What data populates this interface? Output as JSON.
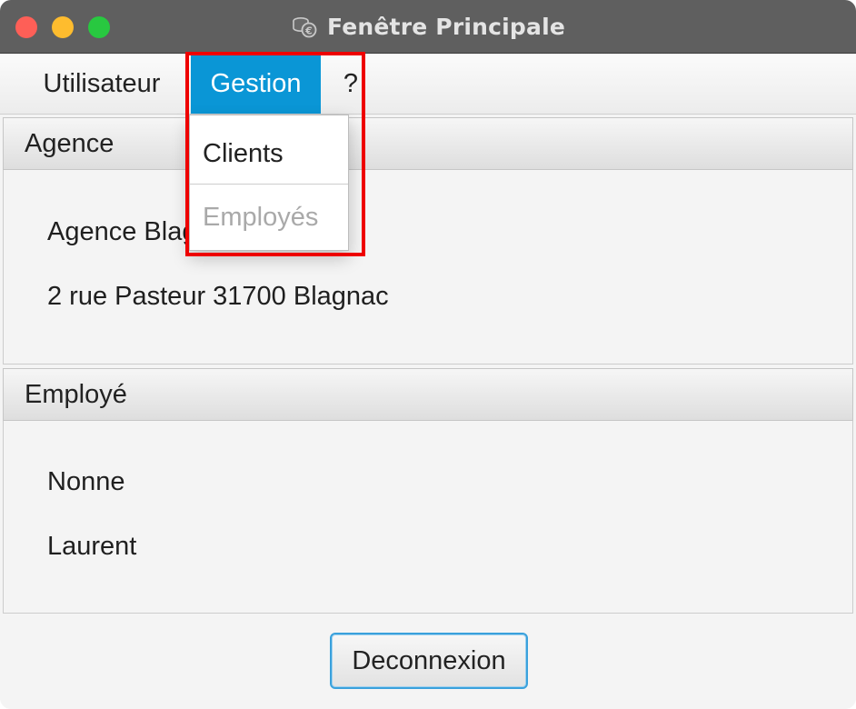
{
  "window": {
    "title": "Fenêtre Principale",
    "title_icon": "coins-icon"
  },
  "menubar": {
    "items": [
      {
        "label": "Utilisateur"
      },
      {
        "label": "Gestion",
        "state": "open"
      },
      {
        "label": "?"
      }
    ]
  },
  "dropdown": {
    "items": [
      {
        "label": "Clients",
        "enabled": true
      },
      {
        "label": "Employés",
        "enabled": false
      }
    ]
  },
  "agence_pane": {
    "title": "Agence",
    "lines": [
      "Agence Blagnac",
      "2 rue Pasteur 31700 Blagnac"
    ]
  },
  "employe_pane": {
    "title": "Employé",
    "lines": [
      "Nonne",
      "Laurent"
    ]
  },
  "footer": {
    "logout_label": "Deconnexion"
  },
  "colors": {
    "titlebar": "#5f5f5f",
    "menu_selected": "#0a96d6",
    "highlight": "#ee0000",
    "disabled_text": "#a9a9a9"
  }
}
